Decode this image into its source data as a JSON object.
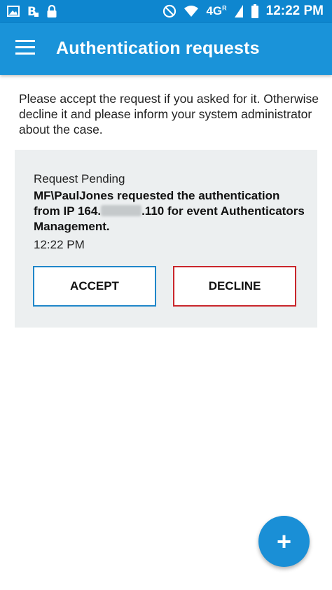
{
  "status_bar": {
    "network": "4G",
    "network_suffix": "R",
    "time": "12:22 PM"
  },
  "app_bar": {
    "title": "Authentication requests"
  },
  "intro_text": "Please accept the request if you asked for it. Otherwise decline it and please inform your system administrator about the case.",
  "request": {
    "status": "Request Pending",
    "message_part1": "MF\\PaulJones requested the authentication from IP 164.",
    "message_part2": ".110 for event Authenticators Management.",
    "time": "12:22 PM",
    "accept_label": "ACCEPT",
    "decline_label": "DECLINE"
  },
  "fab": {
    "symbol": "+"
  },
  "colors": {
    "status_bar": "#0e86cf",
    "app_bar": "#1a93d9",
    "card_background": "#eceff0",
    "accept_border": "#1f86c9",
    "decline_border": "#c9262b",
    "fab": "#1a8fd6"
  }
}
